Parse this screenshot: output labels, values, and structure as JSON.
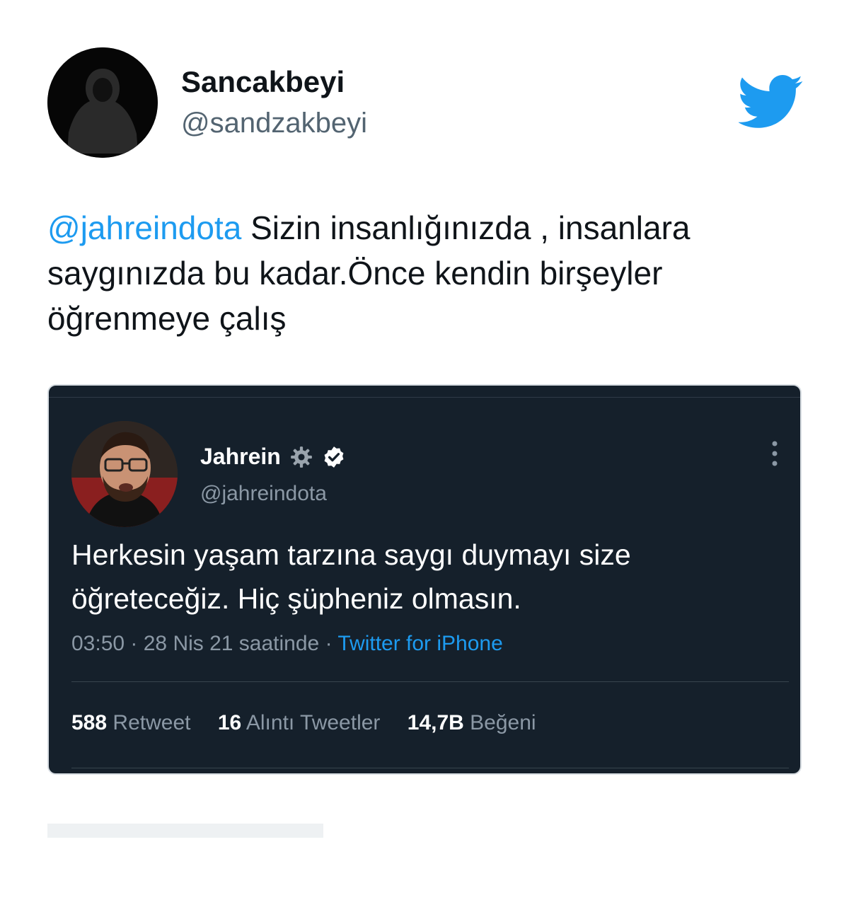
{
  "tweet": {
    "display_name": "Sancakbeyi",
    "handle": "@sandzakbeyi",
    "mention": "@jahreindota",
    "text": " Sizin insanlığınızda , insanlara saygınızda bu kadar.Önce kendin birşeyler öğrenmeye çalış"
  },
  "quoted": {
    "display_name": "Jahrein",
    "handle": "@jahreindota",
    "text": "Herkesin yaşam tarzına saygı duymayı size öğreteceğiz. Hiç şüpheniz olmasın.",
    "time_date": "03:50 · 28 Nis 21 saatinde · ",
    "source": "Twitter for iPhone",
    "stats": {
      "retweets_count": "588",
      "retweets_label": "Retweet",
      "quotes_count": "16",
      "quotes_label": "Alıntı Tweetler",
      "likes_count": "14,7B",
      "likes_label": "Beğeni"
    }
  },
  "colors": {
    "accent": "#1d9bf0",
    "card_bg": "#15202b",
    "muted": "#8b98a5"
  },
  "icons": [
    "twitter-bird-icon",
    "gear-icon",
    "verified-badge-icon",
    "more-options-icon"
  ]
}
